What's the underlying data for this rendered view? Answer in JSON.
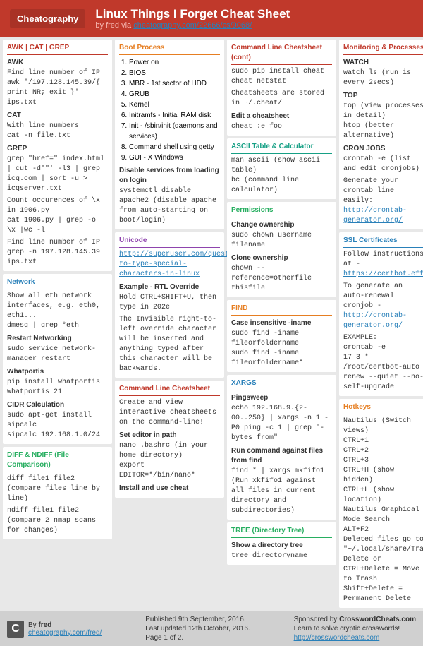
{
  "header": {
    "logo": "Cheatography",
    "title": "Linux Things I Forget Cheat Sheet",
    "subtitle": "by fred via cheatography.com/22666/cs/9068/"
  },
  "footer": {
    "left": {
      "author": "By fred",
      "link": "cheatography.com/fred/"
    },
    "center": {
      "published": "Published 9th September, 2016.",
      "updated": "Last updated 12th October, 2016.",
      "page": "Page 1 of 2."
    },
    "right": {
      "sponsored": "Sponsored by CrosswordCheats.com",
      "tagline": "Learn to solve cryptic crosswords!",
      "link": "http://crosswordcheats.com"
    }
  }
}
